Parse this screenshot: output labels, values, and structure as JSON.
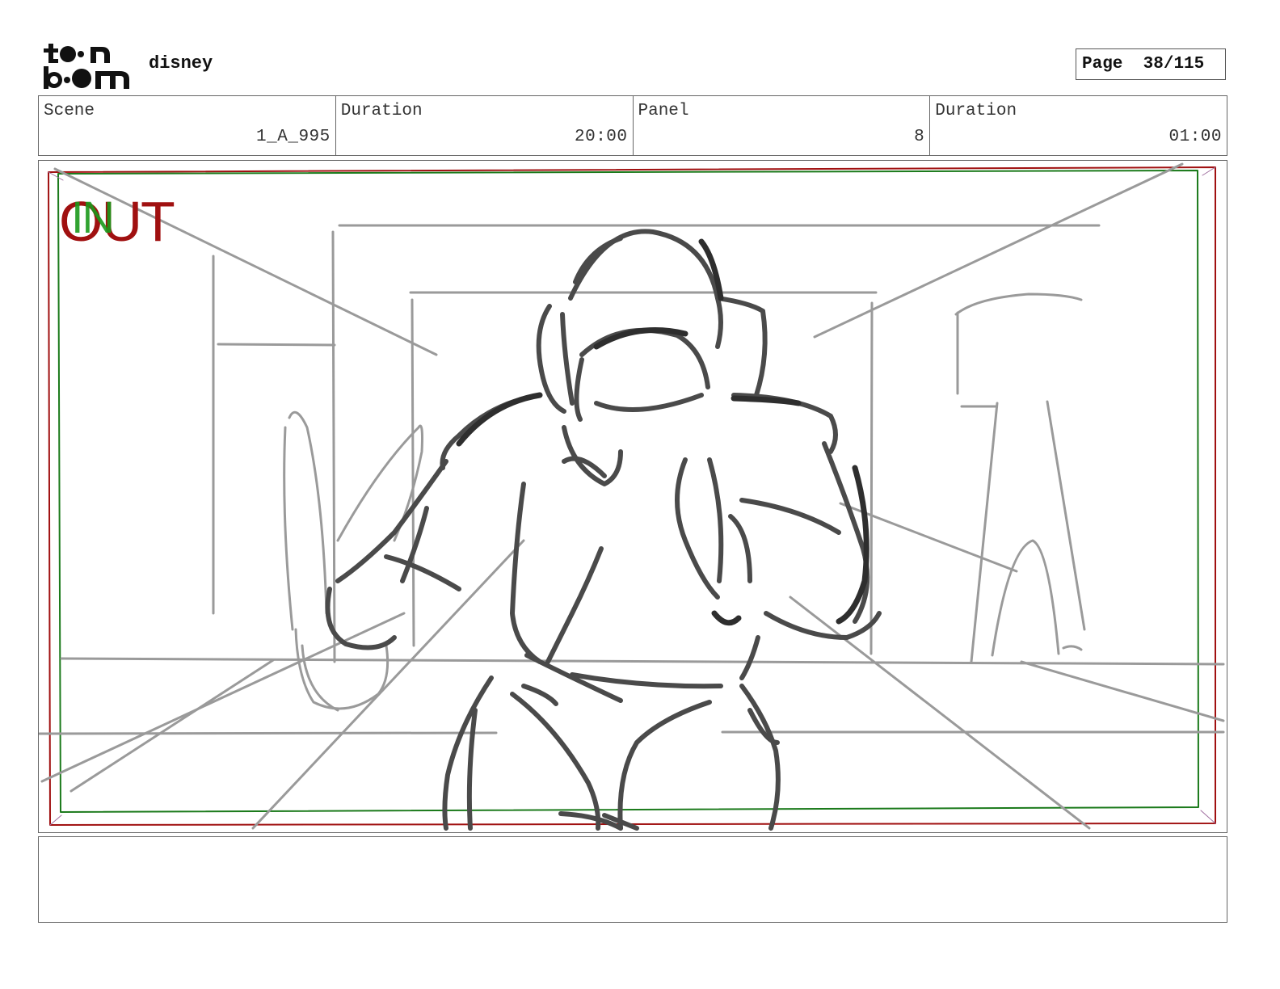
{
  "header": {
    "logo_text": "toonboom",
    "brand": "disney",
    "page_label": "Page",
    "page_value": "38/115"
  },
  "info": {
    "scene_label": "Scene",
    "scene_value": "1_A_995",
    "scene_duration_label": "Duration",
    "scene_duration_value": "20:00",
    "panel_label": "Panel",
    "panel_value": "8",
    "panel_duration_label": "Duration",
    "panel_duration_value": "01:00"
  },
  "panel": {
    "out_label": "OUT",
    "in_label": "IN",
    "out_frame_color": "#a01010",
    "in_frame_color": "#1b7a1b",
    "sketch_description_icon": "storyboard-sketch-figure-in-room"
  },
  "notes": {
    "text": ""
  }
}
